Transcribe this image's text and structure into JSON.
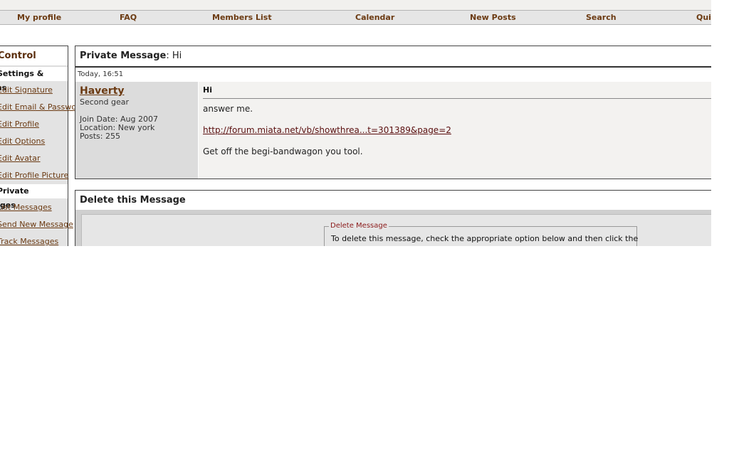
{
  "nav": {
    "items": [
      "My profile",
      "FAQ",
      "Members List",
      "Calendar",
      "New Posts",
      "Search",
      "Quick Links"
    ]
  },
  "sidebar": {
    "title": "Control Panel",
    "sections": [
      "Settings & Options",
      "Private Messages"
    ],
    "settings_links": [
      "Edit Signature",
      "Edit Email & Password",
      "Edit Profile",
      "Edit Options",
      "Edit Avatar",
      "Edit Profile Picture"
    ],
    "pm_links": [
      "List Messages",
      "Send New Message",
      "Track Messages"
    ]
  },
  "message": {
    "header_label": "Private Message",
    "header_subject": "Hi",
    "date": "Today, 16:51",
    "user": {
      "name": "Haverty",
      "title": "Second gear",
      "join_date": "Join Date: Aug 2007",
      "location": "Location: New york",
      "posts": "Posts: 255"
    },
    "title": "Hi",
    "body_line1": "answer me.",
    "link": "http://forum.miata.net/vb/showthrea...t=301389&page=2",
    "body_line3": "Get off the begi-bandwagon you tool."
  },
  "delete": {
    "heading": "Delete this Message",
    "legend": "Delete Message",
    "text": "To delete this message, check the appropriate option below and then click the"
  },
  "colors": {
    "link_brown": "#6b3a12",
    "legend_red": "#8b1a1a"
  }
}
